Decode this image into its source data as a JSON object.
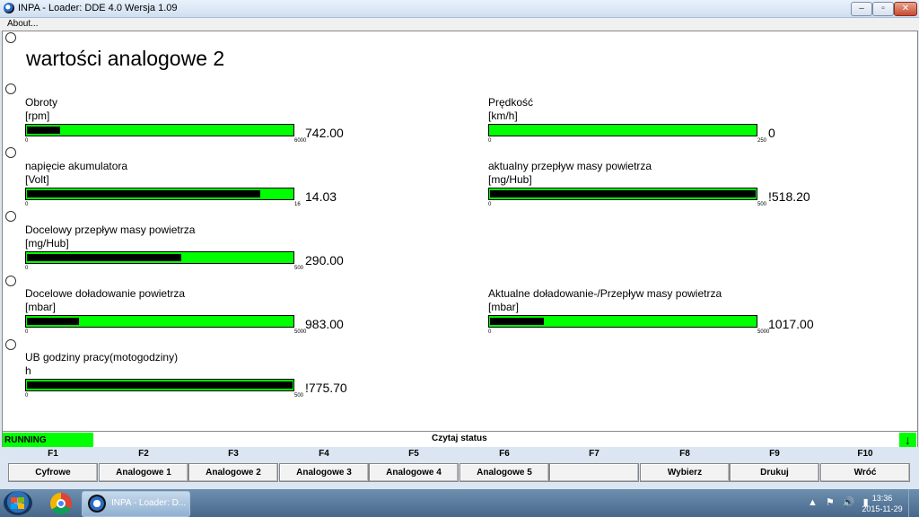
{
  "window": {
    "title": "INPA - Loader:  DDE 4.0 Wersja 1.09",
    "min_label": "–",
    "max_label": "▫",
    "close_label": "✕"
  },
  "menu": {
    "about": "About..."
  },
  "page": {
    "heading": "wartości analogowe 2"
  },
  "gauges": [
    {
      "id": "obroty",
      "label": "Obroty",
      "unit": "[rpm]",
      "min": "0",
      "max": "6000",
      "value": "742.00",
      "fraction": 0.124
    },
    {
      "id": "predkosc",
      "label": "Prędkość",
      "unit": "[km/h]",
      "min": "0",
      "max": "250",
      "value": "0",
      "fraction": 0
    },
    {
      "id": "napiecie",
      "label": "napięcie akumulatora",
      "unit": "[Volt]",
      "min": "0",
      "max": "16",
      "value": "14.03",
      "fraction": 0.877
    },
    {
      "id": "przeplyw-aktualny",
      "label": "aktualny przepływ masy powietrza",
      "unit": "[mg/Hub]",
      "min": "0",
      "max": "500",
      "value": "!518.20",
      "fraction": 1.0
    },
    {
      "id": "przeplyw-docelowy",
      "label": "Docelowy przepływ masy powietrza",
      "unit": "[mg/Hub]",
      "min": "0",
      "max": "500",
      "value": "290.00",
      "fraction": 0.58
    },
    {
      "id": "doladowanie-docelowe",
      "label": "Docelowe doładowanie powietrza",
      "unit": "[mbar]",
      "min": "0",
      "max": "5000",
      "value": "983.00",
      "fraction": 0.197
    },
    {
      "id": "doladowanie-aktualne",
      "label": "Aktualne doładowanie-/Przepływ masy powietrza",
      "unit": "[mbar]",
      "min": "0",
      "max": "5000",
      "value": "1017.00",
      "fraction": 0.203
    },
    {
      "id": "ub-godziny",
      "label": "UB godziny pracy(motogodziny)",
      "unit": "h",
      "min": "0",
      "max": "500",
      "value": "!775.70",
      "fraction": 1.0
    }
  ],
  "status": {
    "running": "RUNNING",
    "title": "Czytaj status",
    "arrow": "↓"
  },
  "fkeys": [
    {
      "key": "F1",
      "label": "Cyfrowe"
    },
    {
      "key": "F2",
      "label": "Analogowe 1"
    },
    {
      "key": "F3",
      "label": "Analogowe 2"
    },
    {
      "key": "F4",
      "label": "Analogowe 3"
    },
    {
      "key": "F5",
      "label": "Analogowe 4"
    },
    {
      "key": "F6",
      "label": "Analogowe 5"
    },
    {
      "key": "F7",
      "label": ""
    },
    {
      "key": "F8",
      "label": "Wybierz"
    },
    {
      "key": "F9",
      "label": "Drukuj"
    },
    {
      "key": "F10",
      "label": "Wróć"
    }
  ],
  "taskbar": {
    "task_label": "INPA - Loader:  D...",
    "time": "13:36",
    "date": "2015-11-29",
    "tray_up": "▲",
    "tray_flag": "⚑",
    "tray_speaker": "🔊",
    "tray_battery": "▮"
  },
  "colors": {
    "bar_green": "#00ff00",
    "fill_black": "#000000"
  }
}
